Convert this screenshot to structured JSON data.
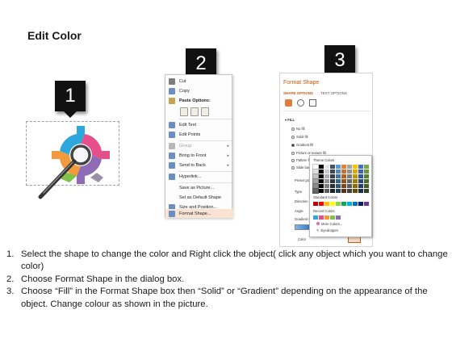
{
  "title": "Edit Color",
  "badges": [
    "1",
    "2",
    "3"
  ],
  "context_menu": {
    "items": [
      {
        "label": "Cut",
        "icon": "scissors-icon",
        "color": "#5b5b5b"
      },
      {
        "label": "Copy",
        "icon": "copy-icon",
        "color": "#6a8fc7"
      },
      {
        "label": "Paste Options:",
        "icon": "paste-icon",
        "color": "#c9a24a"
      },
      {
        "label": "Edit Text",
        "icon": "edit-text-icon",
        "color": "#6a8fc7"
      },
      {
        "label": "Edit Points",
        "icon": "edit-points-icon",
        "color": "#6a8fc7"
      },
      {
        "label": "Group",
        "icon": "group-icon",
        "color": "#9a9a9a"
      },
      {
        "label": "Bring to Front",
        "icon": "bring-front-icon",
        "color": "#6a8fc7"
      },
      {
        "label": "Send to Back",
        "icon": "send-back-icon",
        "color": "#6a8fc7"
      },
      {
        "label": "Hyperlink...",
        "icon": "hyperlink-icon",
        "color": "#6a8fc7"
      },
      {
        "label": "Save as Picture...",
        "icon": "",
        "color": ""
      },
      {
        "label": "Set as Default Shape",
        "icon": "",
        "color": ""
      },
      {
        "label": "Size and Position...",
        "icon": "size-position-icon",
        "color": "#6a8fc7"
      },
      {
        "label": "Format Shape...",
        "icon": "format-shape-icon",
        "color": "#6a8fc7"
      }
    ]
  },
  "format_pane": {
    "title": "Format Shape",
    "tab_shape": "SHAPE OPTIONS",
    "tab_text": "TEXT OPTIONS",
    "section": "FILL",
    "options": [
      "No fill",
      "Solid fill",
      "Gradient fill",
      "Picture or texture fill",
      "Pattern fill",
      "Slide background fill"
    ],
    "fields": [
      "Preset gradient",
      "Type",
      "Direction",
      "Angle",
      "Gradient stops",
      "Color"
    ]
  },
  "color_picker": {
    "theme_label": "Theme Colors",
    "standard_label": "Standard Colors",
    "recent_label": "Recent Colors",
    "more_colors": "More Colors...",
    "eyedropper": "Eyedropper"
  },
  "instructions": [
    {
      "num": "1.",
      "text": "Select the shape to change the color and Right click the object( click any object which you want to change color)"
    },
    {
      "num": "2.",
      "text": "Choose Format Shape in the dialog box."
    },
    {
      "num": "3.",
      "text": "Choose “Fill” in the Format Shape box then “Solid” or “Gradient” depending on the appearance of the object. Change colour as shown in the picture."
    }
  ]
}
